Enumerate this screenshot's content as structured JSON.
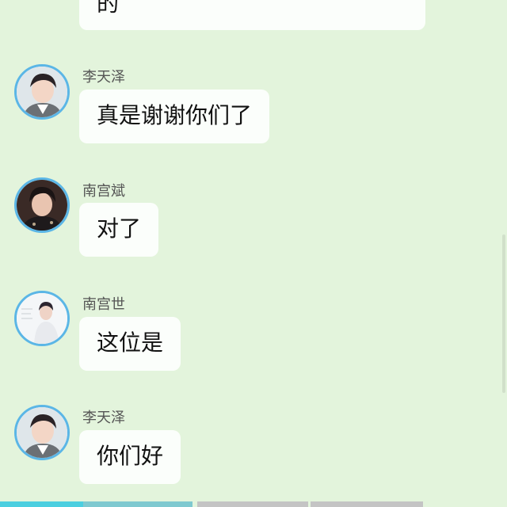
{
  "messages": [
    {
      "sender": "",
      "text": "的",
      "avatar": ""
    },
    {
      "sender": "李天泽",
      "text": "真是谢谢你们了",
      "avatar": "avatar-li-tianze"
    },
    {
      "sender": "南宫斌",
      "text": "对了",
      "avatar": "avatar-nangong-bin"
    },
    {
      "sender": "南宫世",
      "text": "这位是",
      "avatar": "avatar-nangong-shi"
    },
    {
      "sender": "李天泽",
      "text": "你们好",
      "avatar": "avatar-li-tianze"
    }
  ],
  "colors": {
    "background": "#e3f4dc",
    "bubble": "#fbfefb",
    "avatar_ring": "#5bb6e6",
    "tab_active": "#4ccfe0",
    "tab_inactive": "#c4c4c4"
  }
}
